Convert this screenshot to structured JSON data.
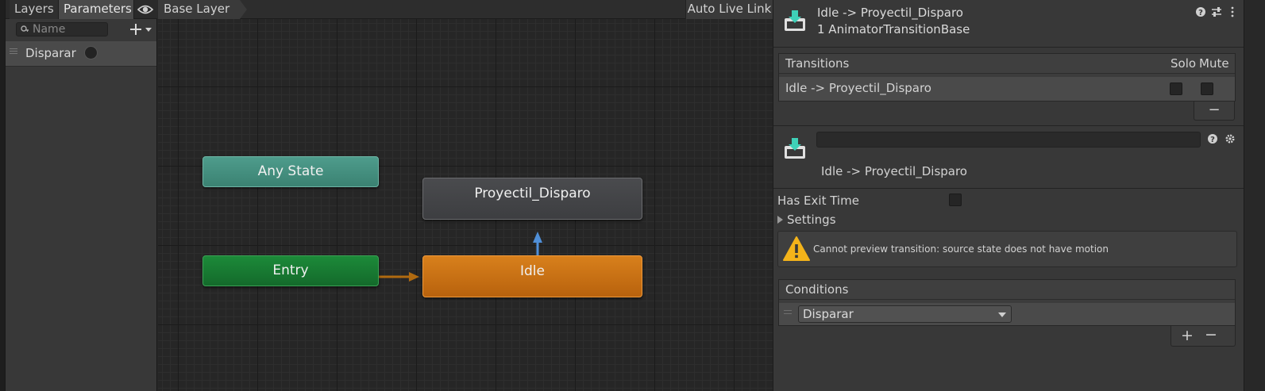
{
  "params_panel": {
    "tabs": [
      {
        "label": "Layers"
      },
      {
        "label": "Parameters"
      }
    ],
    "search": {
      "placeholder": "Name"
    },
    "add_icon": "plus-dropdown-icon",
    "parameters": [
      {
        "name": "Disparar",
        "type": "trigger"
      }
    ]
  },
  "graph": {
    "breadcrumb": "Base Layer",
    "auto_live_link": "Auto Live Link",
    "states": {
      "any_state": "Any State",
      "entry": "Entry",
      "proyectil": "Proyectil_Disparo",
      "idle": "Idle"
    },
    "colors": {
      "any_state": "#4e9c8c",
      "entry": "#1c8a39",
      "idle": "#d8801c",
      "default_state": "#4a4b4e",
      "selected_transition": "#4f8fd8",
      "entry_transition": "#b06a10"
    }
  },
  "inspector": {
    "title": "Idle -> Proyectil_Disparo",
    "subtitle": "1 AnimatorTransitionBase",
    "transitions": {
      "header": "Transitions",
      "solo_label": "Solo",
      "mute_label": "Mute",
      "rows": [
        {
          "label": "Idle -> Proyectil_Disparo",
          "solo": false,
          "mute": false
        }
      ],
      "remove_label": "−"
    },
    "transition": {
      "name_value": "",
      "name_label": "Idle -> Proyectil_Disparo",
      "has_exit_time_label": "Has Exit Time",
      "has_exit_time": false,
      "settings_label": "Settings",
      "warning": "Cannot preview transition: source state does not have motion"
    },
    "conditions": {
      "header": "Conditions",
      "items": [
        {
          "parameter": "Disparar"
        }
      ],
      "add_label": "+",
      "remove_label": "−"
    }
  }
}
